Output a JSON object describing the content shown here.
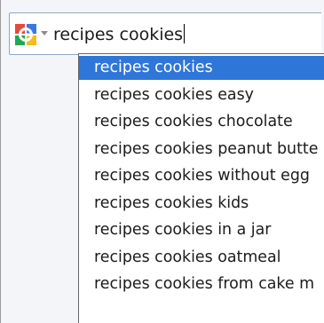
{
  "search": {
    "engine_icon": "google-g-icon",
    "query": "recipes cookies"
  },
  "suggestions": [
    "recipes cookies",
    "recipes cookies easy",
    "recipes cookies chocolate",
    "recipes cookies peanut butte",
    "recipes cookies without egg",
    "recipes cookies kids",
    "recipes cookies in a jar",
    "recipes cookies oatmeal",
    "recipes cookies from cake m"
  ],
  "selected_index": 0,
  "colors": {
    "selection": "#2f76d9",
    "border": "#8fa7c4"
  }
}
